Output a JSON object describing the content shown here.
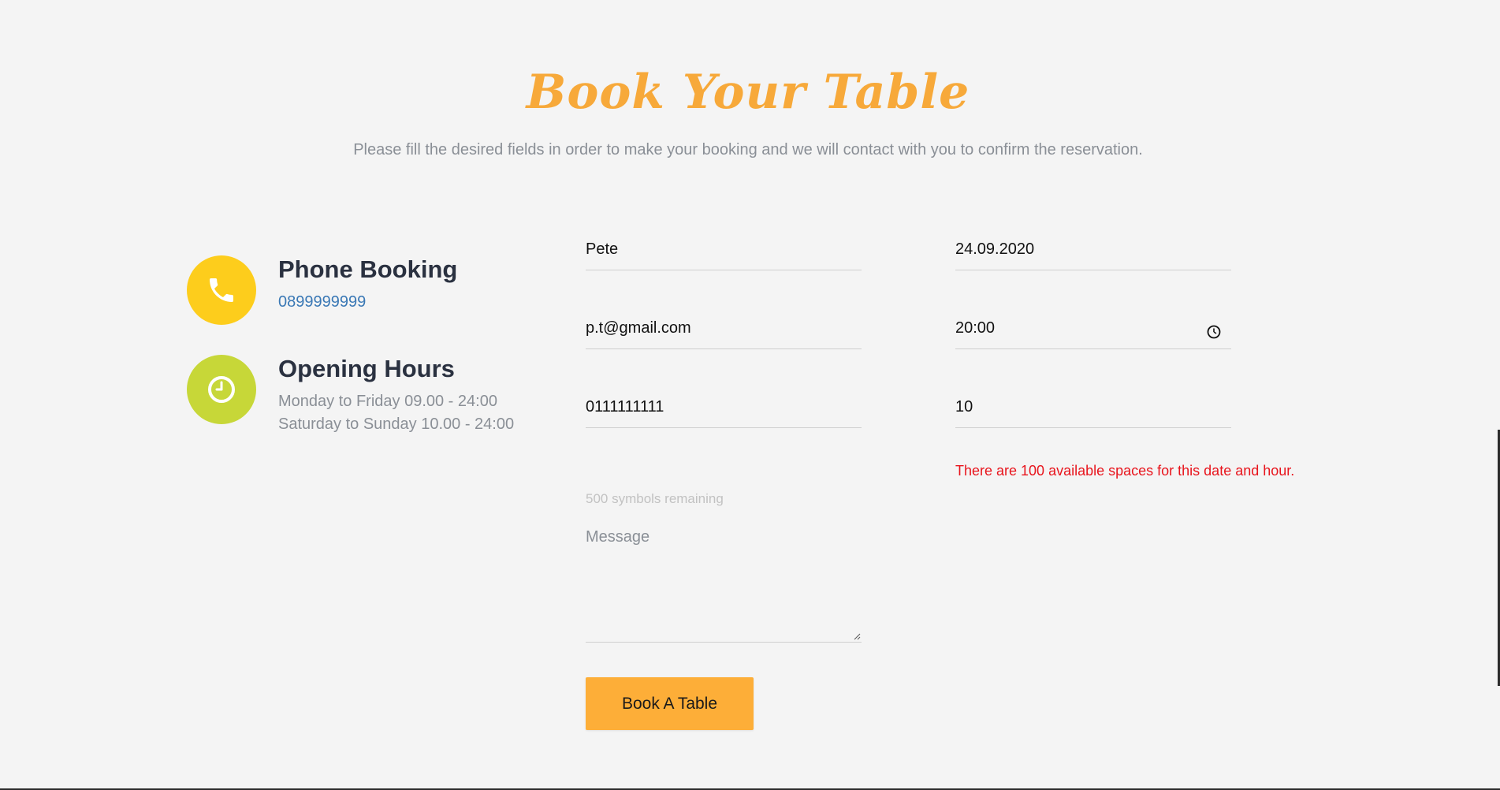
{
  "header": {
    "title": "Book Your Table",
    "subtitle": "Please fill the desired fields in order to make your booking and we will contact with you to confirm the reservation."
  },
  "info": {
    "phone": {
      "icon": "phone-icon",
      "icon_color": "#fdcd1c",
      "heading": "Phone Booking",
      "number": "0899999999"
    },
    "hours": {
      "icon": "clock-icon",
      "icon_color": "#c7d738",
      "heading": "Opening Hours",
      "weekdays": "Monday to Friday 09.00 - 24:00",
      "weekend": "Saturday to Sunday 10.00 - 24:00"
    }
  },
  "form": {
    "name": {
      "value": "Pete"
    },
    "email": {
      "value": "p.t@gmail.com"
    },
    "phone": {
      "value": "0111111111"
    },
    "date": {
      "value": "24.09.2020"
    },
    "time": {
      "value": "20:00"
    },
    "guests": {
      "value": "10"
    },
    "availability_message": "There are 100 available spaces for this date and hour.",
    "symbols_remaining": "500 symbols remaining",
    "message": {
      "placeholder": "Message",
      "value": ""
    },
    "submit_label": "Book A Table"
  },
  "colors": {
    "accent": "#f7a93a",
    "button": "#fdae38",
    "error": "#e8141c",
    "link": "#3a78b5"
  }
}
